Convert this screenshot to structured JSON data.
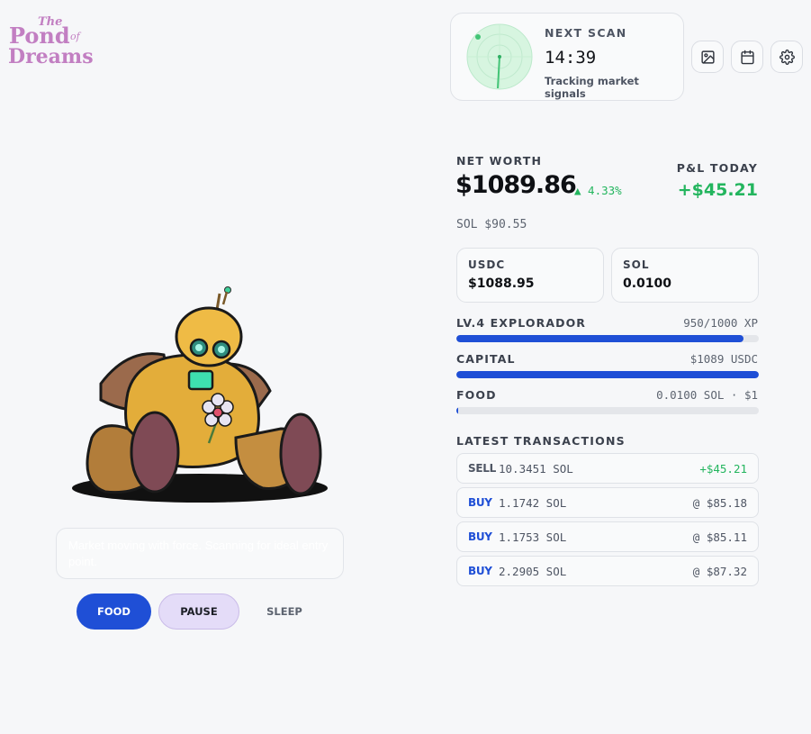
{
  "brand": {
    "logo_text": "The Pond of Dreams",
    "color": "#c27fc2"
  },
  "scan": {
    "label": "NEXT SCAN",
    "time": "14:39",
    "subtitle": "Tracking market signals"
  },
  "toolbar": {
    "icons": [
      "image-icon",
      "calendar-icon",
      "gear-icon"
    ]
  },
  "portfolio": {
    "net_worth_label": "NET WORTH",
    "net_worth": "$1089.86",
    "change": "▲ 4.33%",
    "pnl_label": "P&L TODAY",
    "pnl_value": "+$45.21",
    "sol_price": "SOL $90.55",
    "balances": [
      {
        "label": "USDC",
        "value": "$1088.95"
      },
      {
        "label": "SOL",
        "value": "0.0100"
      }
    ]
  },
  "stats": {
    "level": {
      "label": "LV.4 EXPLORADOR",
      "value": "950/1000 XP",
      "fill": 0.95
    },
    "capital": {
      "label": "CAPITAL",
      "value": "$1089 USDC",
      "fill": 1.0
    },
    "food": {
      "label": "FOOD",
      "value": "0.0100 SOL · $1",
      "fill": 0.005
    }
  },
  "transactions": {
    "title": "LATEST TRANSACTIONS",
    "rows": [
      {
        "type": "SELL",
        "amount": "10.3451 SOL",
        "price": "+$45.21"
      },
      {
        "type": "BUY",
        "amount": "1.1742 SOL",
        "price": "@ $85.18"
      },
      {
        "type": "BUY",
        "amount": "1.1753 SOL",
        "price": "@ $85.11"
      },
      {
        "type": "BUY",
        "amount": "2.2905 SOL",
        "price": "@ $87.32"
      }
    ]
  },
  "colors": {
    "accent": "#1f4fd6",
    "positive": "#23b55e",
    "pause_bg": "#e4dcf8"
  },
  "message": "Market moving with force. Scanning for ideal entry point.",
  "actions": {
    "food": "FOOD",
    "pause": "PAUSE",
    "sleep": "SLEEP"
  }
}
